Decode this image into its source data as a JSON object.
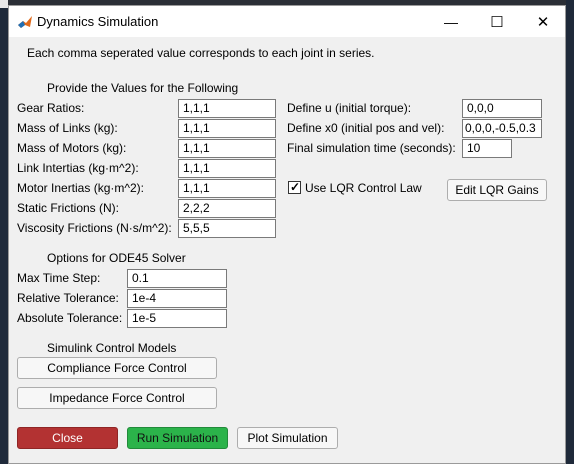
{
  "window": {
    "title": "Dynamics Simulation",
    "controls": {
      "minimize": "—",
      "maximize": "☐",
      "close": "✕"
    }
  },
  "info_text": "Each comma seperated value corresponds to each joint in series.",
  "params": {
    "heading": "Provide the Values for the Following",
    "fields": [
      {
        "label": "Gear Ratios:",
        "value": "1,1,1"
      },
      {
        "label": "Mass of Links (kg):",
        "value": "1,1,1"
      },
      {
        "label": "Mass of Motors (kg):",
        "value": "1,1,1"
      },
      {
        "label": "Link Intertias (kg·m^2):",
        "value": "1,1,1"
      },
      {
        "label": "Motor Inertias (kg·m^2):",
        "value": "1,1,1"
      },
      {
        "label": "Static Frictions (N):",
        "value": "2,2,2"
      },
      {
        "label": "Viscosity Frictions (N·s/m^2):",
        "value": "5,5,5"
      }
    ]
  },
  "right": {
    "define_u": {
      "label": "Define u (initial torque):",
      "value": "0,0,0"
    },
    "define_x0": {
      "label": "Define x0 (initial pos and vel):",
      "value": "0,0,0,-0.5,0.3"
    },
    "final_time": {
      "label": "Final simulation time (seconds):",
      "value": "10"
    },
    "lqr_checkbox": {
      "label": "Use LQR Control Law",
      "checked": true,
      "mark": "✓"
    },
    "edit_lqr_button": "Edit LQR Gains"
  },
  "ode": {
    "heading": "Options for ODE45 Solver",
    "fields": [
      {
        "label": "Max Time Step:",
        "value": "0.1"
      },
      {
        "label": "Relative Tolerance:",
        "value": "1e-4"
      },
      {
        "label": "Absolute Tolerance:",
        "value": "1e-5"
      }
    ]
  },
  "simulink": {
    "heading": "Simulink Control Models",
    "compliance_button": "Compliance Force Control",
    "impedance_button": "Impedance Force Control"
  },
  "footer": {
    "close_button": "Close",
    "run_button": "Run Simulation",
    "plot_button": "Plot Simulation"
  },
  "colors": {
    "close_button_bg": "#b33232",
    "run_button_bg": "#2bb34a",
    "window_bg": "#f0f0f0"
  }
}
